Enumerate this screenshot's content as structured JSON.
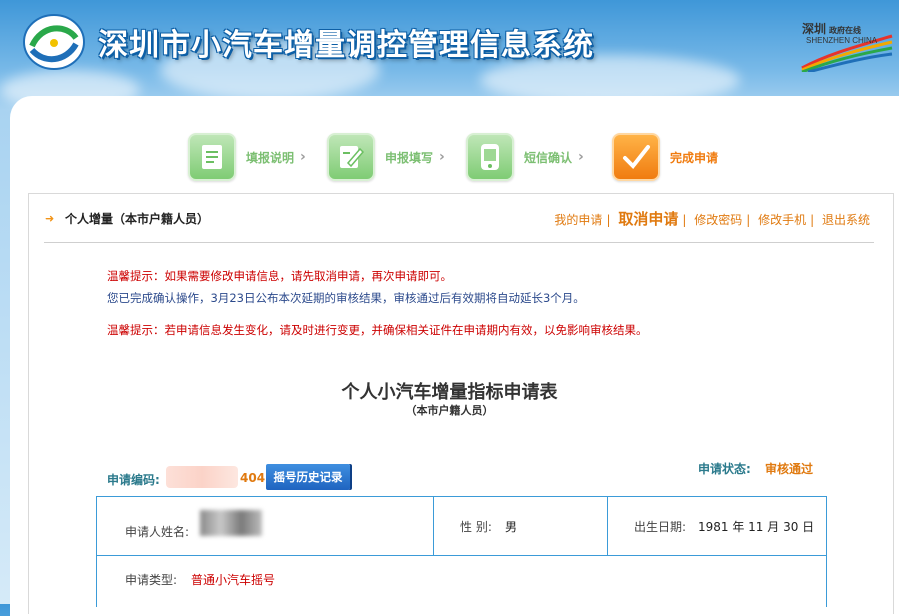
{
  "header": {
    "title": "深圳市小汽车增量调控管理信息系统",
    "sz_logo_cn": "深圳",
    "sz_logo_cn2": "政府在线",
    "sz_logo_en": "SHENZHEN CHINA"
  },
  "steps": [
    {
      "label": "填报说明",
      "icon": "document-list-icon",
      "active": false
    },
    {
      "label": "申报填写",
      "icon": "edit-form-icon",
      "active": false
    },
    {
      "label": "短信确认",
      "icon": "mobile-phone-icon",
      "active": false
    },
    {
      "label": "完成申请",
      "icon": "checkmark-icon",
      "active": true
    }
  ],
  "crumb": "个人增量（本市户籍人员）",
  "links": {
    "my_app": "我的申请",
    "cancel": "取消申请",
    "change_pwd": "修改密码",
    "change_phone": "修改手机",
    "logout": "退出系统",
    "sep": "|"
  },
  "tips": {
    "tip1": "温馨提示：如果需要修改申请信息，请先取消申请，再次申请即可。",
    "tip2": "您已完成确认操作，3月23日公布本次延期的审核结果，审核通过后有效期将自动延长3个月。",
    "tip3": "温馨提示：若申请信息发生变化，请及时进行变更，并确保相关证件在申请期内有效，以免影响审核结果。"
  },
  "form": {
    "title": "个人小汽车增量指标申请表",
    "subtitle": "（本市户籍人员）",
    "code_label": "申请编码:",
    "code_tail": "404",
    "history_button": "摇号历史记录",
    "status_label": "申请状态:",
    "status_value": "审核通过"
  },
  "info": {
    "name_label": "申请人姓名:",
    "gender_label": "性 别:",
    "gender_value": "男",
    "birth_label": "出生日期:",
    "birth_value": "1981 年 11 月 30 日",
    "type_label": "申请类型:",
    "type_value": "普通小汽车摇号"
  },
  "colors": {
    "accent_orange": "#e07a10",
    "warning_red": "#cc0000",
    "info_blue": "#2c4a8c",
    "table_border": "#3b9bd8",
    "step_green": "#7fcc74"
  }
}
